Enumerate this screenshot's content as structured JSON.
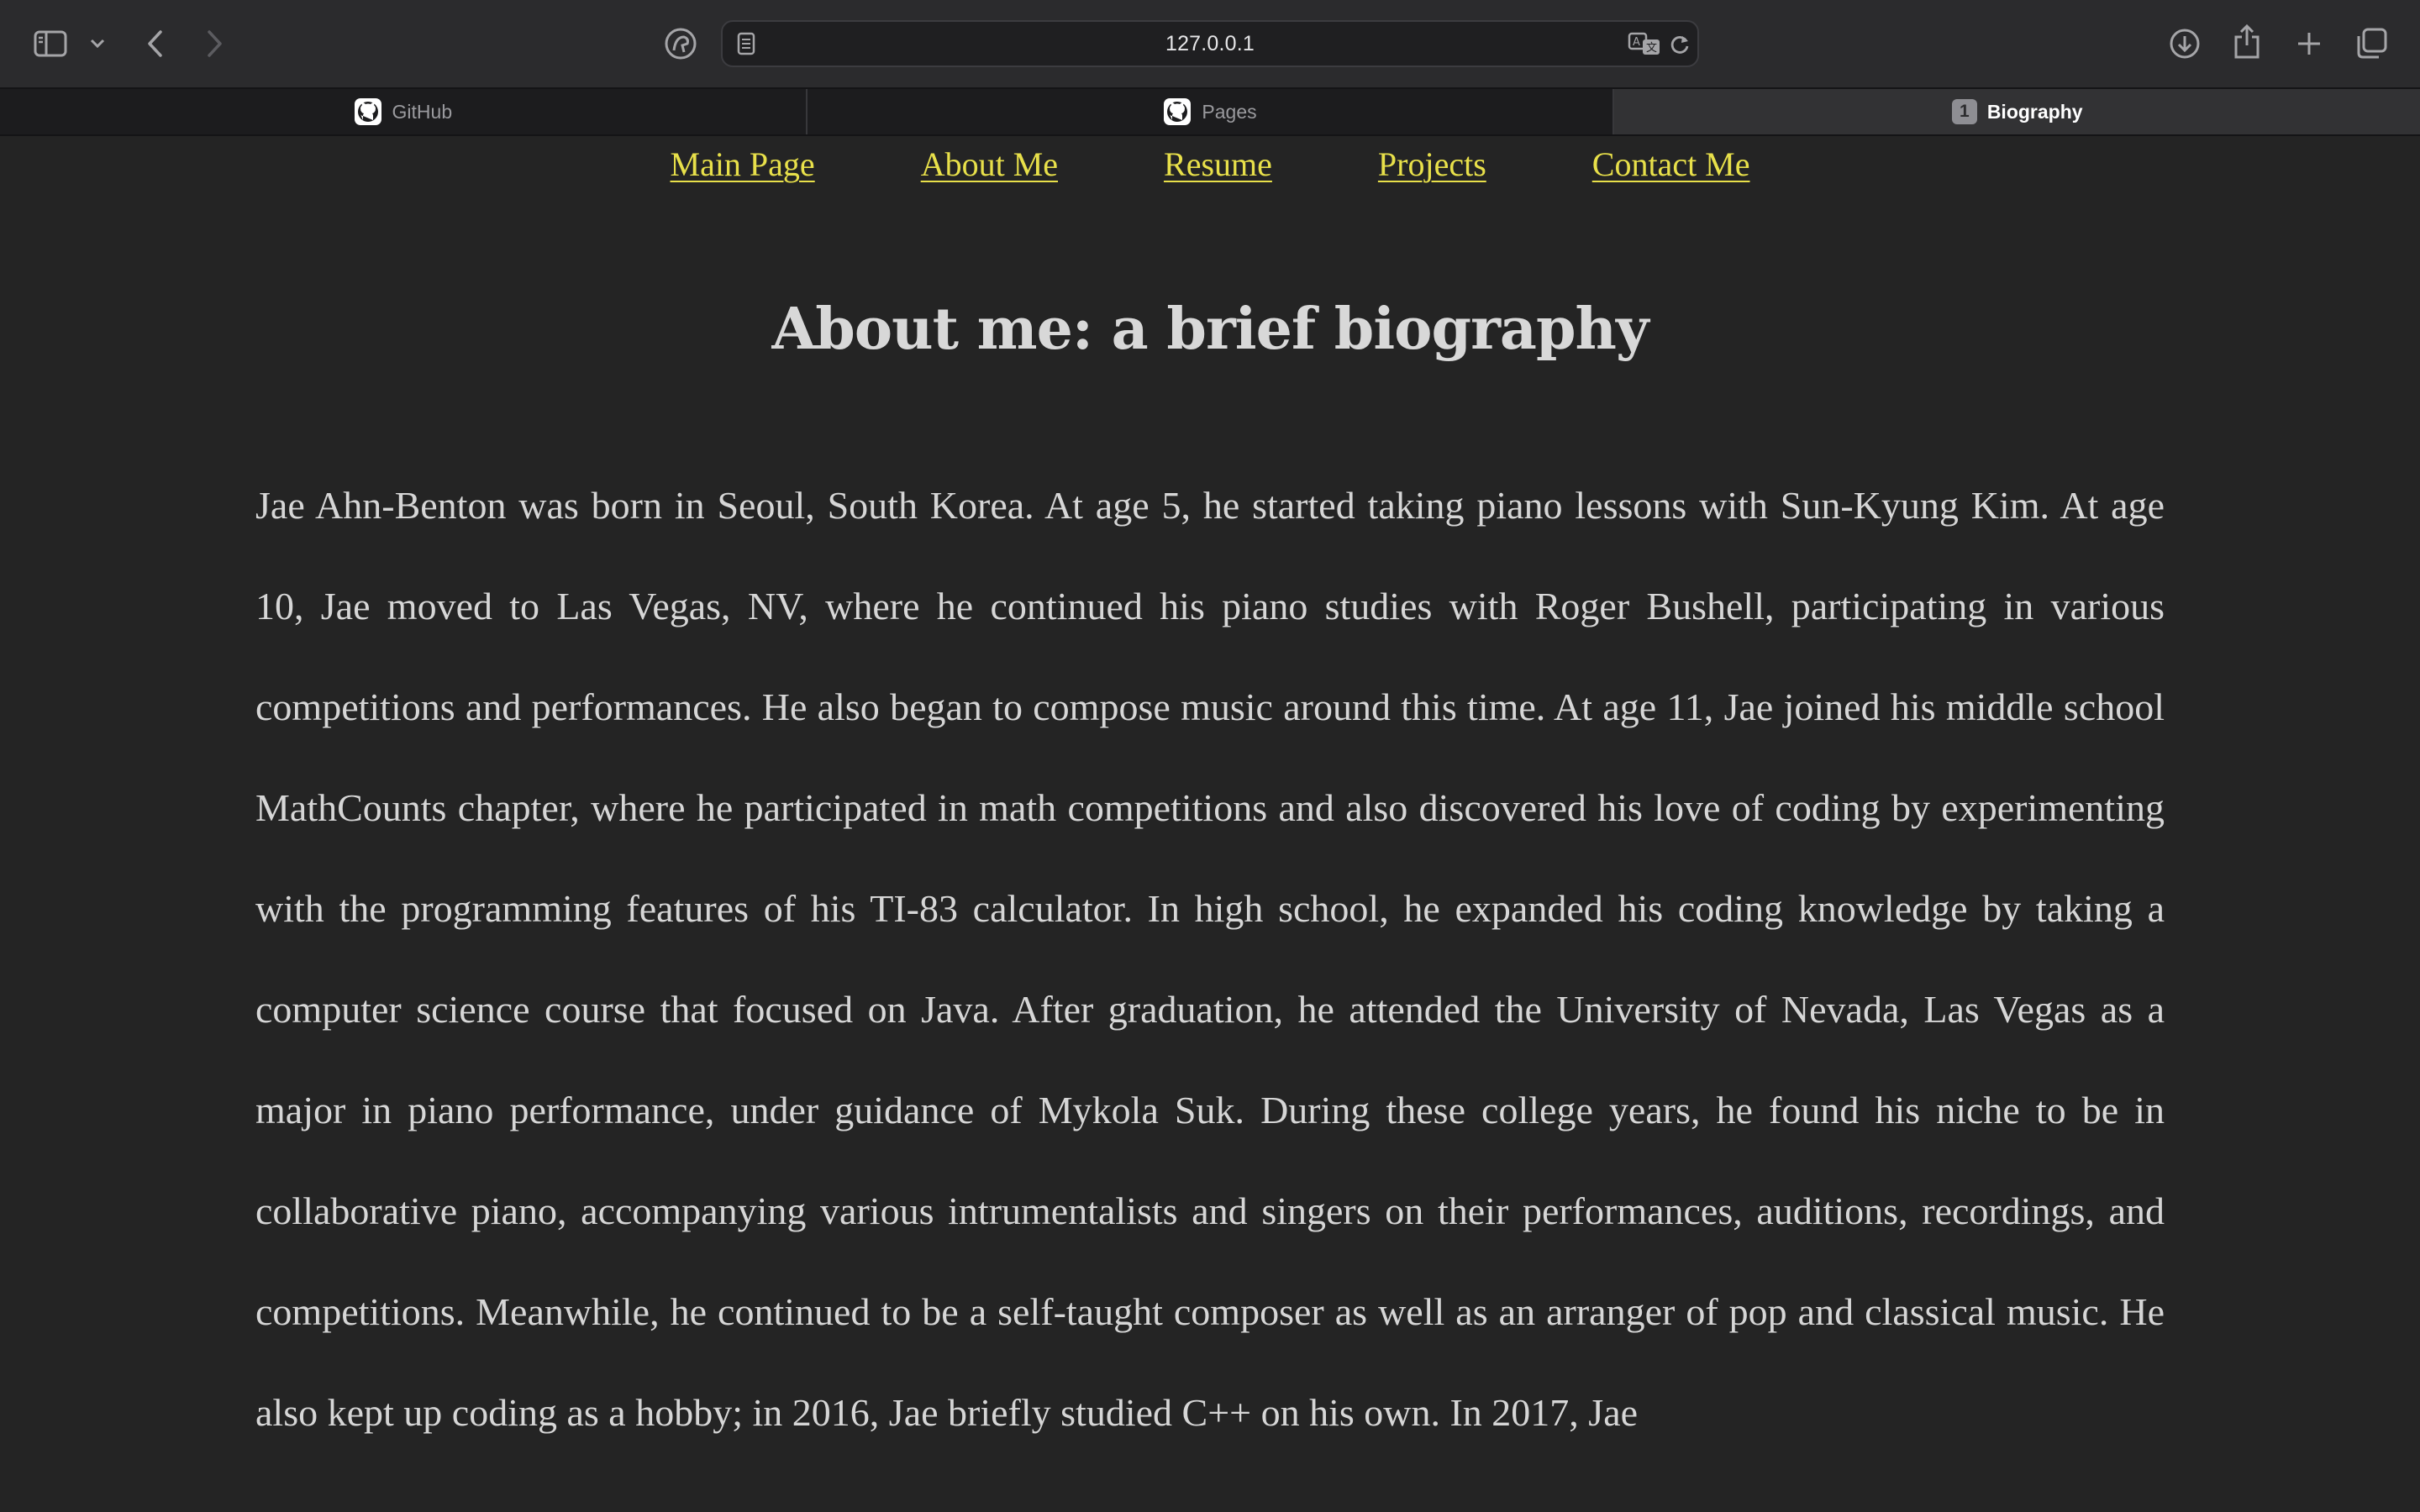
{
  "browser": {
    "url": "127.0.0.1",
    "tabs": [
      {
        "label": "GitHub",
        "icon": "github-icon",
        "active": false
      },
      {
        "label": "Pages",
        "icon": "github-icon",
        "active": false
      },
      {
        "label": "Biography",
        "badge": "1",
        "active": true
      }
    ],
    "toolbar_icons": [
      "sidebar-icon",
      "chevron-down-icon",
      "back-icon",
      "forward-icon",
      "privacy-icon",
      "reader-icon",
      "translate-icon",
      "reload-icon",
      "download-icon",
      "share-icon",
      "new-tab-icon",
      "tab-overview-icon"
    ]
  },
  "nav": {
    "links": [
      "Main Page",
      "About Me",
      "Resume",
      "Projects",
      "Contact Me"
    ]
  },
  "page": {
    "title": "About me: a brief biography",
    "bio": "Jae Ahn-Benton was born in Seoul, South Korea. At age 5, he started taking piano lessons with Sun-Kyung Kim. At age 10, Jae moved to Las Vegas, NV, where he continued his piano studies with Roger Bushell, participating in various competitions and performances. He also began to compose music around this time. At age 11, Jae joined his middle school MathCounts chapter, where he participated in math competitions and also discovered his love of coding by experimenting with the programming features of his TI-83 calculator. In high school, he expanded his coding knowledge by taking a computer science course that focused on Java. After graduation, he attended the University of Nevada, Las Vegas as a major in piano performance, under guidance of Mykola Suk. During these college years, he found his niche to be in collaborative piano, accompanying various intrumentalists and singers on their performances, auditions, recordings, and competitions. Meanwhile, he continued to be a self-taught composer as well as an arranger of pop and classical music. He also kept up coding as a hobby; in 2016, Jae briefly studied C++ on his own. In 2017, Jae"
  },
  "colors": {
    "link": "#e8e04a",
    "background": "#242424",
    "text": "#d6d6d6"
  }
}
